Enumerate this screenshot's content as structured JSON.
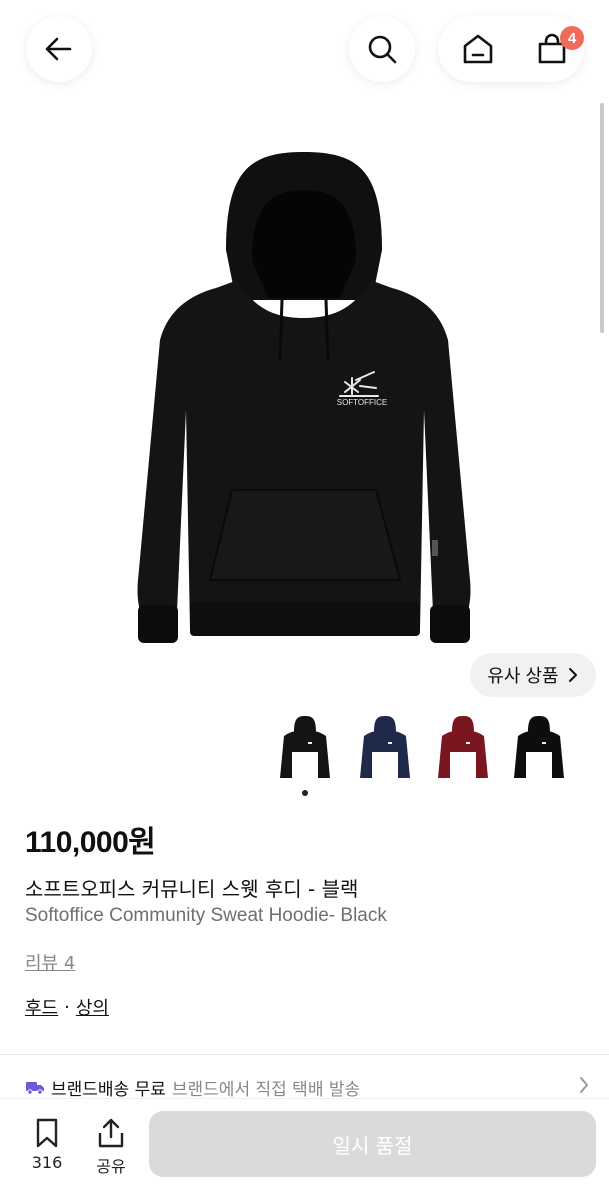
{
  "header": {
    "back_icon": "arrow-left-icon",
    "search_icon": "search-icon",
    "home_icon": "home-icon",
    "cart_icon": "shopping-bag-icon",
    "cart_count": "4",
    "badge_color": "#f26a5a"
  },
  "hero": {
    "logo_text": "SOFTOFFICE",
    "similar_label": "유사 상품",
    "similar_icon": "chevron-right-icon"
  },
  "thumbnails": [
    {
      "color_name": "black",
      "color": "#141414"
    },
    {
      "color_name": "navy",
      "color": "#1f2a4a"
    },
    {
      "color_name": "burgundy",
      "color": "#7a1620"
    },
    {
      "color_name": "black-alt",
      "color": "#0d0d0d"
    }
  ],
  "product": {
    "price": "110,000원",
    "title_ko": "소프트오피스 커뮤니티 스웻 후디 - 블랙",
    "title_en": "Softoffice Community Sweat Hoodie- Black",
    "reviews": "리뷰 4",
    "category_1": "후드",
    "category_sep": "·",
    "category_2": "상의"
  },
  "shipping": {
    "icon": "truck-icon",
    "strong": "브랜드배송 무료",
    "muted": "브랜드에서 직접 택배 발송"
  },
  "bottom_bar": {
    "bookmark_icon": "bookmark-icon",
    "bookmark_count": "316",
    "share_icon": "share-icon",
    "share_label": "공유",
    "action_label": "일시 품절"
  }
}
